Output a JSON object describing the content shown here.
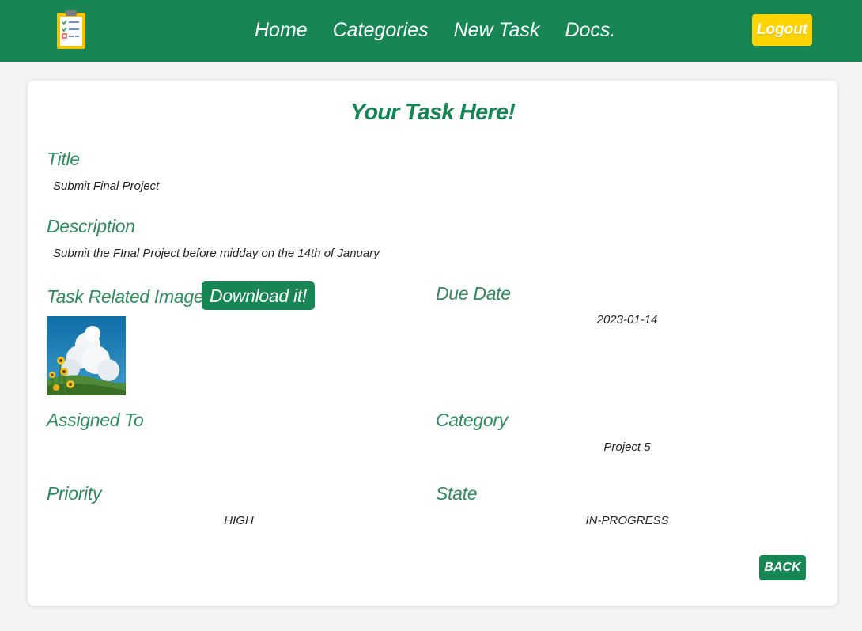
{
  "header": {
    "logo_icon": "clipboard-checklist-icon",
    "nav": [
      "Home",
      "Categories",
      "New Task",
      "Docs."
    ],
    "logout_label": "Logout",
    "colors": {
      "brand_green": "#178554",
      "logout_yellow": "#ffd400"
    }
  },
  "task": {
    "heading": "Your Task Here!",
    "title_label": "Title",
    "title_value": "Submit Final Project",
    "description_label": "Description",
    "description_value": "Submit the FInal Project before midday on the 14th of January",
    "image_label": "Task Related Image",
    "download_label": "Download it!",
    "due_date_label": "Due Date",
    "due_date_value": "2023-01-14",
    "assigned_label": "Assigned To",
    "assigned_value": "",
    "category_label": "Category",
    "category_value": "Project 5",
    "priority_label": "Priority",
    "priority_value": "HIGH",
    "state_label": "State",
    "state_value": "IN-PROGRESS",
    "back_label": "BACK"
  }
}
